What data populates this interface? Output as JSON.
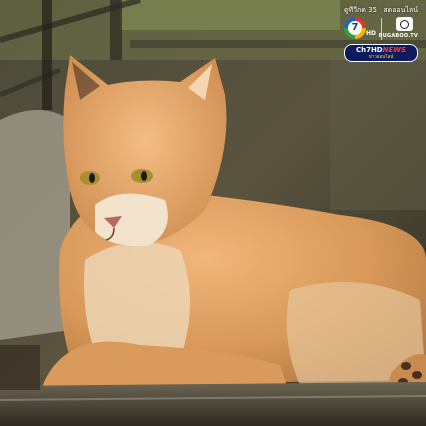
{
  "photo": {
    "subject": "jungle-cat"
  },
  "watermark": {
    "channel_caption": "ดูทีวีกด 35",
    "live_caption": "สดออนไลน์",
    "channel_mark": "7",
    "hd_mark": "HD",
    "bugaboo_text": "BUGABOO.TV",
    "news_brand": "Ch7HD",
    "news_brand_accent": "NEWS",
    "news_tagline": "ข่าวออนไลน์"
  }
}
